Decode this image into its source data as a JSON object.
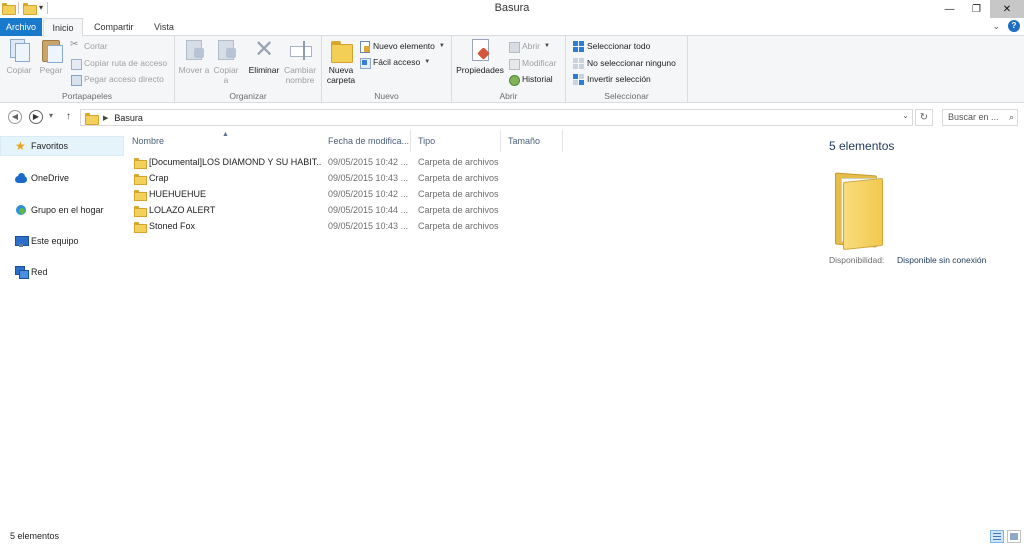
{
  "window": {
    "title": "Basura",
    "minimize_glyph": "—",
    "maximize_glyph": "❐",
    "close_glyph": "✕"
  },
  "ribbon_tabs": {
    "file": "Archivo",
    "home": "Inicio",
    "share": "Compartir",
    "view": "Vista"
  },
  "ribbon": {
    "clipboard": {
      "copy": "Copiar",
      "paste": "Pegar",
      "cut": "Cortar",
      "copy_path": "Copiar ruta de acceso",
      "paste_shortcut": "Pegar acceso directo",
      "label": "Portapapeles"
    },
    "organize": {
      "move_to": "Mover a",
      "copy_to": "Copiar a",
      "delete": "Eliminar",
      "rename": "Cambiar nombre",
      "label": "Organizar"
    },
    "new": {
      "new_folder": "Nueva carpeta",
      "new_item": "Nuevo elemento",
      "easy_access": "Fácil acceso",
      "label": "Nuevo"
    },
    "open": {
      "properties": "Propiedades",
      "open": "Abrir",
      "edit": "Modificar",
      "history": "Historial",
      "label": "Abrir"
    },
    "select": {
      "select_all": "Seleccionar todo",
      "select_none": "No seleccionar ninguno",
      "invert": "Invertir selección",
      "label": "Seleccionar"
    }
  },
  "address_bar": {
    "path": "Basura",
    "search_placeholder": "Buscar en ..."
  },
  "navigation": {
    "items": [
      {
        "label": "Favoritos",
        "icon": "star-icon"
      },
      {
        "label": "OneDrive",
        "icon": "cloud-icon"
      },
      {
        "label": "Grupo en el hogar",
        "icon": "homegroup-icon"
      },
      {
        "label": "Este equipo",
        "icon": "computer-icon"
      },
      {
        "label": "Red",
        "icon": "network-icon"
      }
    ]
  },
  "file_list": {
    "columns": [
      "Nombre",
      "Fecha de modifica...",
      "Tipo",
      "Tamaño"
    ],
    "rows": [
      {
        "name": "[Documental]LOS DIAMOND Y SU HABIT...",
        "date": "09/05/2015 10:42 ...",
        "type": "Carpeta de archivos"
      },
      {
        "name": "Crap",
        "date": "09/05/2015 10:43 ...",
        "type": "Carpeta de archivos"
      },
      {
        "name": "HUEHUEHUE",
        "date": "09/05/2015 10:42 ...",
        "type": "Carpeta de archivos"
      },
      {
        "name": "LOLAZO ALERT",
        "date": "09/05/2015 10:44 ...",
        "type": "Carpeta de archivos"
      },
      {
        "name": "Stoned Fox",
        "date": "09/05/2015 10:43 ...",
        "type": "Carpeta de archivos"
      }
    ]
  },
  "details_pane": {
    "count": "5 elementos",
    "availability_label": "Disponibilidad:",
    "availability_value": "Disponible sin conexión"
  },
  "status_bar": {
    "text": "5 elementos"
  },
  "colors": {
    "file_tab": "#1979ca",
    "ribbon_bg": "#f5f6f7",
    "selection": "#e5f3fb",
    "folder": "#f3cf5c",
    "link_text": "#1e395b"
  }
}
